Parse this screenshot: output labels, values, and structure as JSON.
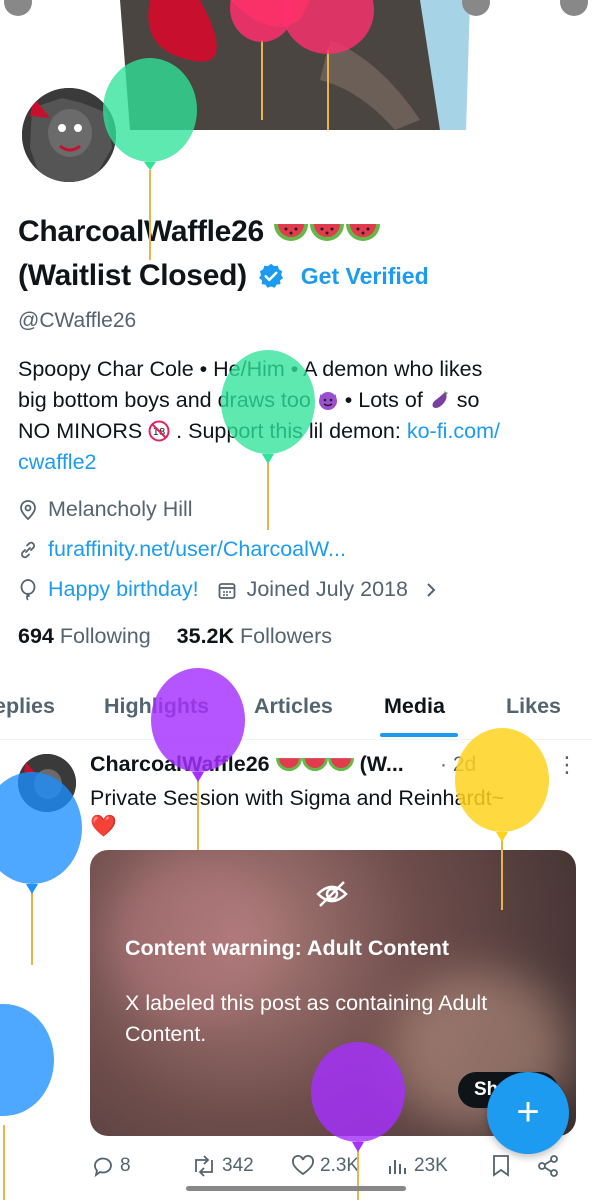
{
  "profile": {
    "display_name_line1": "CharcoalWaffle26",
    "display_name_line2": "(Waitlist Closed)",
    "get_verified": "Get Verified",
    "handle": "@CWaffle26",
    "bio": {
      "line1": "Spoopy Char Cole • He/Him • A demon who likes",
      "line2a": "big bottom boys and draws too",
      "line2b": " • Lots of ",
      "line2c": " so",
      "line3a": "NO MINORS ",
      "line3b": " .  Support this lil demon: ",
      "link1": "ko-fi.com/",
      "link2": "cwaffle2"
    },
    "location": "Melancholy Hill",
    "website": "furaffinity.net/user/CharcoalW...",
    "birthday": "Happy birthday!",
    "joined": "Joined July 2018",
    "following_count": "694",
    "following_label": "Following",
    "followers_count": "35.2K",
    "followers_label": "Followers"
  },
  "tabs": [
    {
      "label": "eplies"
    },
    {
      "label": "Highlights"
    },
    {
      "label": "Articles"
    },
    {
      "label": "Media",
      "active": true
    },
    {
      "label": "Likes"
    }
  ],
  "post": {
    "author": "CharcoalWaffle26",
    "author_suffix": "(W...",
    "time": "· 2d",
    "more": "⋮",
    "text": "Private Session with Sigma and Reinhardt~",
    "heart": "❤️",
    "warning_title": "Content warning: Adult Content",
    "warning_desc": "X labeled this post as containing Adult Content.",
    "show_label": "Sh",
    "replies": "8",
    "reposts": "342",
    "likes": "2.3K",
    "views": "23K"
  },
  "fab_label": "+",
  "colors": {
    "accent": "#1d9bf0",
    "text_primary": "#0f1419",
    "text_secondary": "#536471"
  },
  "icons": [
    "location-icon",
    "link-icon",
    "balloon-icon",
    "calendar-icon",
    "chevron-right-icon",
    "verified-badge-icon",
    "watermelon-icon",
    "eye-off-icon",
    "reply-icon",
    "repost-icon",
    "like-icon",
    "views-icon",
    "bookmark-icon",
    "share-icon"
  ]
}
